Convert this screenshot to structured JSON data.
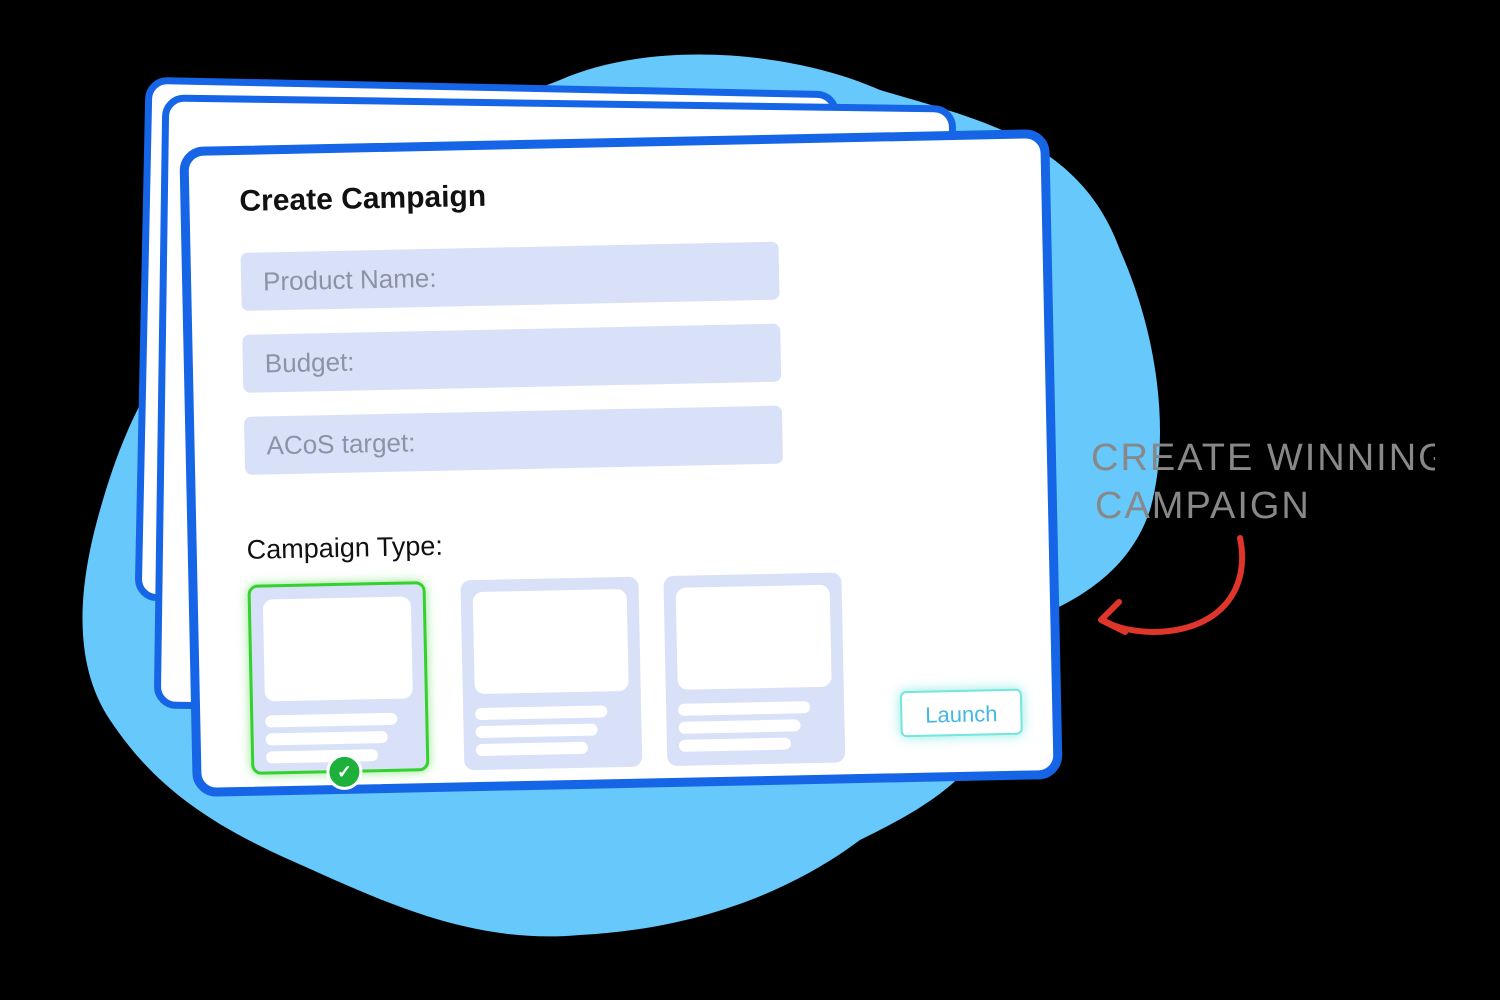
{
  "form": {
    "title": "Create Campaign",
    "fields": [
      {
        "placeholder": "Product Name:"
      },
      {
        "placeholder": "Budget:"
      },
      {
        "placeholder": "ACoS target:"
      }
    ],
    "campaign_type_label": "Campaign Type:",
    "campaign_types": [
      {
        "selected": true
      },
      {
        "selected": false
      },
      {
        "selected": false
      }
    ],
    "launch_label": "Launch"
  },
  "annotation": {
    "text": "CREATE WINNING CAMPAIGN",
    "color": "#888888",
    "arrow_color": "#e0352b",
    "icon": "curved-arrow-icon"
  },
  "colors": {
    "background_blob": "#66c8fb",
    "card_border": "#1565e6",
    "field_fill": "#d8e1f7",
    "selected_border": "#35d12f",
    "check": "#1db03a",
    "launch_glow": "#74e6dc"
  }
}
